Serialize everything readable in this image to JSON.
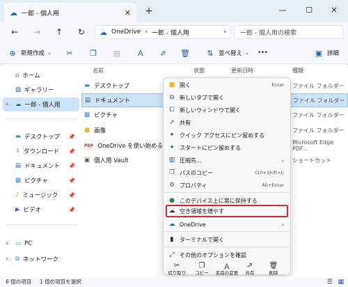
{
  "window": {
    "tab_title": "一郎 - 個人用",
    "tab_close": "✕",
    "new_tab": "+",
    "minimize": "—",
    "maximize": "☐",
    "close": "✕"
  },
  "nav": {
    "address_location": "OneDrive",
    "address_sep": "›",
    "address_folder": "一郎 - 個人用",
    "address_chevron": "›",
    "search_placeholder": "一郎 - 個人用の検索"
  },
  "toolbar": {
    "new_label": "新規作成",
    "sort_label": "並べ替え",
    "more_label": "•••",
    "details_label": "詳細"
  },
  "sidebar": {
    "items": [
      {
        "label": "ホーム",
        "icon": "home-icon"
      },
      {
        "label": "ギャラリー",
        "icon": "gallery-icon"
      },
      {
        "label": "一郎 - 個人用",
        "icon": "cloud-icon"
      },
      {
        "label": "デスクトップ",
        "icon": "desktop-icon"
      },
      {
        "label": "ダウンロード",
        "icon": "download-icon"
      },
      {
        "label": "ドキュメント",
        "icon": "document-icon"
      },
      {
        "label": "ピクチャ",
        "icon": "picture-icon"
      },
      {
        "label": "ミュージック",
        "icon": "music-icon"
      },
      {
        "label": "ビデオ",
        "icon": "video-icon"
      },
      {
        "label": "PC",
        "icon": "pc-icon"
      },
      {
        "label": "ネットワーク",
        "icon": "network-icon"
      }
    ]
  },
  "list": {
    "headers": {
      "name": "名前",
      "status": "状態",
      "modified": "更新日時",
      "type": "種類"
    },
    "rows": [
      {
        "name": "デスクトップ",
        "type": "ファイル フォルダー"
      },
      {
        "name": "ドキュメント",
        "type": "ファイル フォルダー"
      },
      {
        "name": "ピクチャ",
        "type": "ファイル フォルダー"
      },
      {
        "name": "画像",
        "type": "ファイル フォルダー"
      },
      {
        "name": "OneDrive を使い始める",
        "type": "Microsoft Edge PDF..."
      },
      {
        "name": "個人用 Vault",
        "type": "ショートカット"
      }
    ]
  },
  "context_menu": {
    "items": [
      {
        "label": "開く",
        "shortcut": "Enter"
      },
      {
        "label": "新しいタブで開く",
        "shortcut": ""
      },
      {
        "label": "新しいウィンドウで開く",
        "shortcut": ""
      },
      {
        "label": "共有",
        "shortcut": ""
      },
      {
        "label": "クイック アクセスにピン留めする",
        "shortcut": ""
      },
      {
        "label": "スタートにピン留めする",
        "shortcut": ""
      },
      {
        "label": "圧縮先...",
        "shortcut": ""
      },
      {
        "label": "パスのコピー",
        "shortcut": "Ctrl+Shift+C"
      },
      {
        "label": "プロパティ",
        "shortcut": "Alt+Enter"
      },
      {
        "label": "このデバイス上に常に保持する",
        "shortcut": ""
      },
      {
        "label": "空き領域を増やす",
        "shortcut": ""
      },
      {
        "label": "OneDrive",
        "shortcut": ""
      },
      {
        "label": "ターミナルで開く",
        "shortcut": ""
      },
      {
        "label": "その他のオプションを確認",
        "shortcut": ""
      }
    ],
    "arrow": "›",
    "bottom": [
      {
        "label": "切り取り"
      },
      {
        "label": "コピー"
      },
      {
        "label": "名前の変更"
      },
      {
        "label": "共有"
      },
      {
        "label": "削除"
      }
    ]
  },
  "status": {
    "count": "6 個の項目",
    "selected": "1 個の項目を選択"
  },
  "colors": {
    "accent": "#0f6cbd",
    "highlight_box": "#e0242c",
    "selection": "#cde3f7"
  }
}
